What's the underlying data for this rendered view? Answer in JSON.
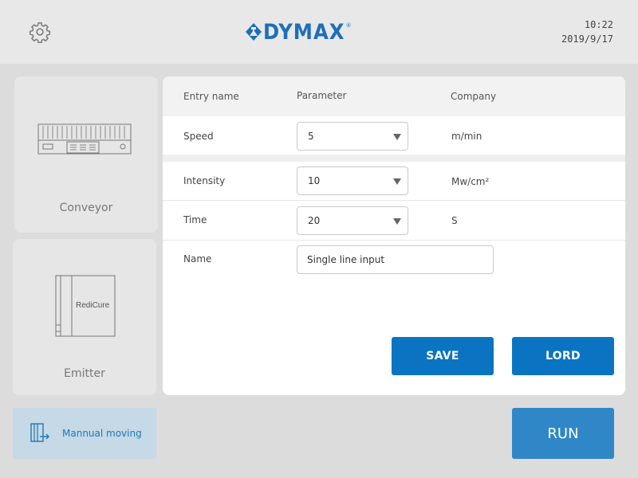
{
  "header": {
    "logo_text": "DYMAX",
    "logo_reg": "®",
    "time": "10:22",
    "date": "2019/9/17",
    "settings_icon": "gear-icon"
  },
  "devices": [
    {
      "label": "Conveyor",
      "icon": "conveyor-icon"
    },
    {
      "label": "Emitter",
      "icon": "redicure-emitter-icon",
      "device_text": "RediCure"
    }
  ],
  "manual": {
    "label": "Mannual moving",
    "icon": "manual-moving-icon"
  },
  "table": {
    "headers": [
      "Entry name",
      "Parameter",
      "Company"
    ],
    "rows": [
      {
        "label": "Speed",
        "value": "5",
        "unit": "m/min"
      },
      {
        "label": "Intensity",
        "value": "10",
        "unit": "Mw/cm²"
      },
      {
        "label": "Time",
        "value": "20",
        "unit": "S"
      }
    ],
    "name_row": {
      "label": "Name",
      "placeholder": "Single line input"
    }
  },
  "actions": {
    "save": "SAVE",
    "lord": "LORD",
    "run": "RUN"
  },
  "colors": {
    "accent": "#0a74c2",
    "run": "#2f87c7",
    "manual_bg": "#c5d9e6",
    "logo": "#1d6fb8"
  }
}
